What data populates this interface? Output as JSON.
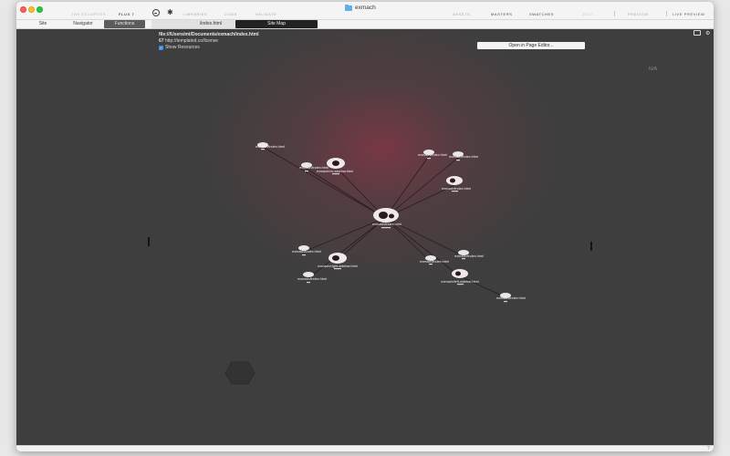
{
  "window": {
    "title": "exmach"
  },
  "toolbar": {
    "brand": "THE ESCAPERS",
    "product": "FLUX 7",
    "libraries": "LIBRARIES",
    "code": "CODE",
    "validate": "VALIDATE",
    "assets": "ASSETS",
    "masters": "MASTERS",
    "swatches": "SWATCHES",
    "edit": "EDIT",
    "preview": "PREVIEW",
    "live_preview": "LIVE PREVIEW"
  },
  "secbar": {
    "tab_site": "Site",
    "tab_navigator": "Navigator",
    "tab_functions": "Functions",
    "path": "/index.html",
    "sitemap": "Site Map"
  },
  "canvas": {
    "url": "file:///Users/mt/Documents/exmach/index.html",
    "license_count": "67",
    "license_url": "http://templated.co/license",
    "show_resources": "Show Resources",
    "open_editor": "Open in Page Editor...",
    "na": "N/A"
  },
  "map": {
    "nodes": {
      "n1": "exmach/index.html",
      "n2": "exmach/index.html",
      "n3": "exmach/no-sidebar.html",
      "n4": "exmach/index.html",
      "n5": "exmach/index.html",
      "n6": "exmach/index.html",
      "n7": "exmach/index.html",
      "n8": "exmach/right-sidebar.html",
      "n9": "exmach/index.html",
      "n10": "exmach/index.html",
      "n11": "exmach/index.html",
      "n12": "exmach/left-sidebar.html",
      "n13": "exmach/index.html",
      "center": "exmach/index.html"
    }
  },
  "statusbar": {
    "help": "?"
  }
}
